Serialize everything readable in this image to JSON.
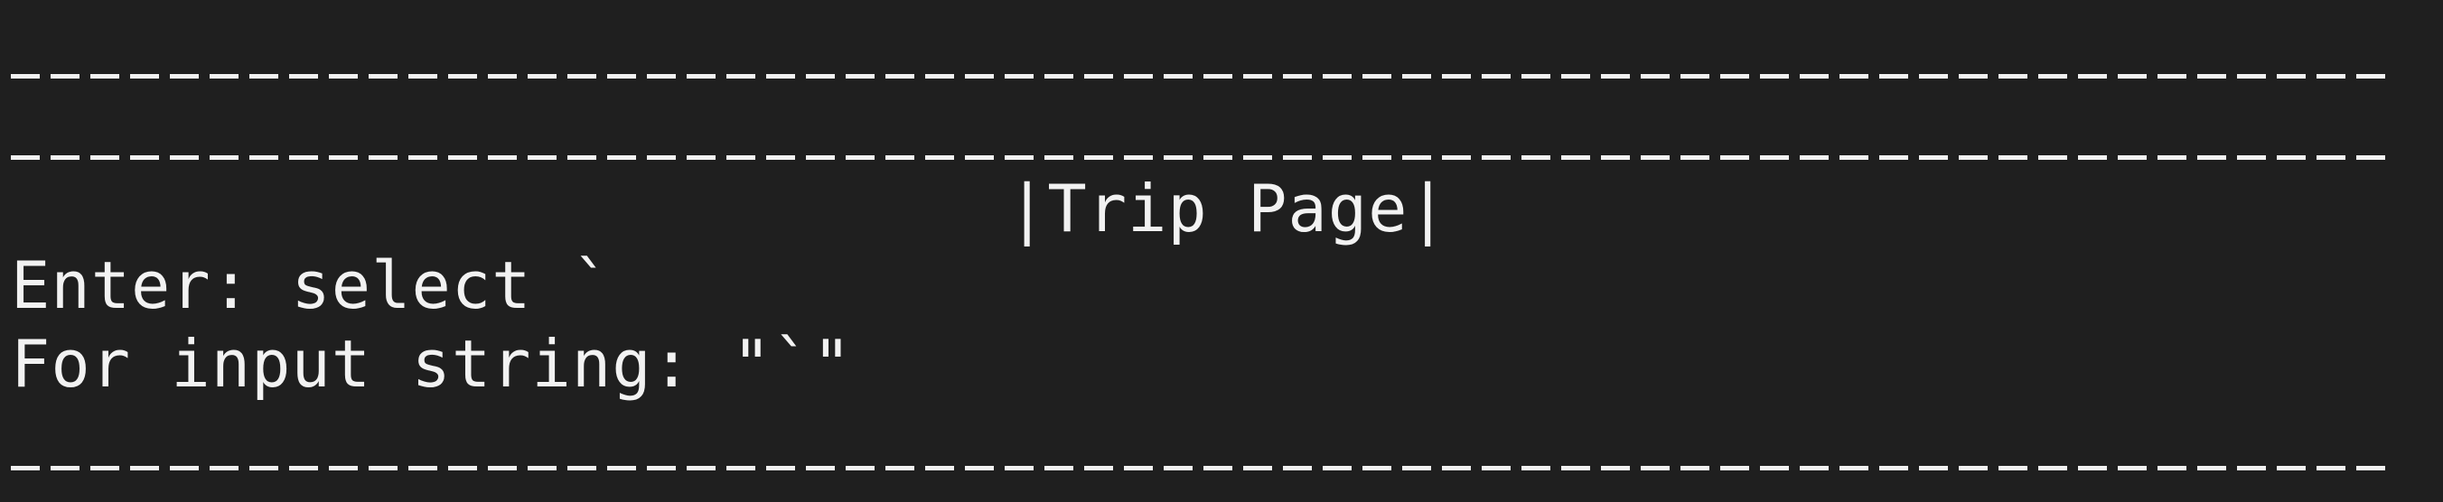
{
  "terminal": {
    "page_title": "|Trip Page|",
    "prompt_line": "Enter: select `",
    "error_line": "For input string: \"`\""
  }
}
